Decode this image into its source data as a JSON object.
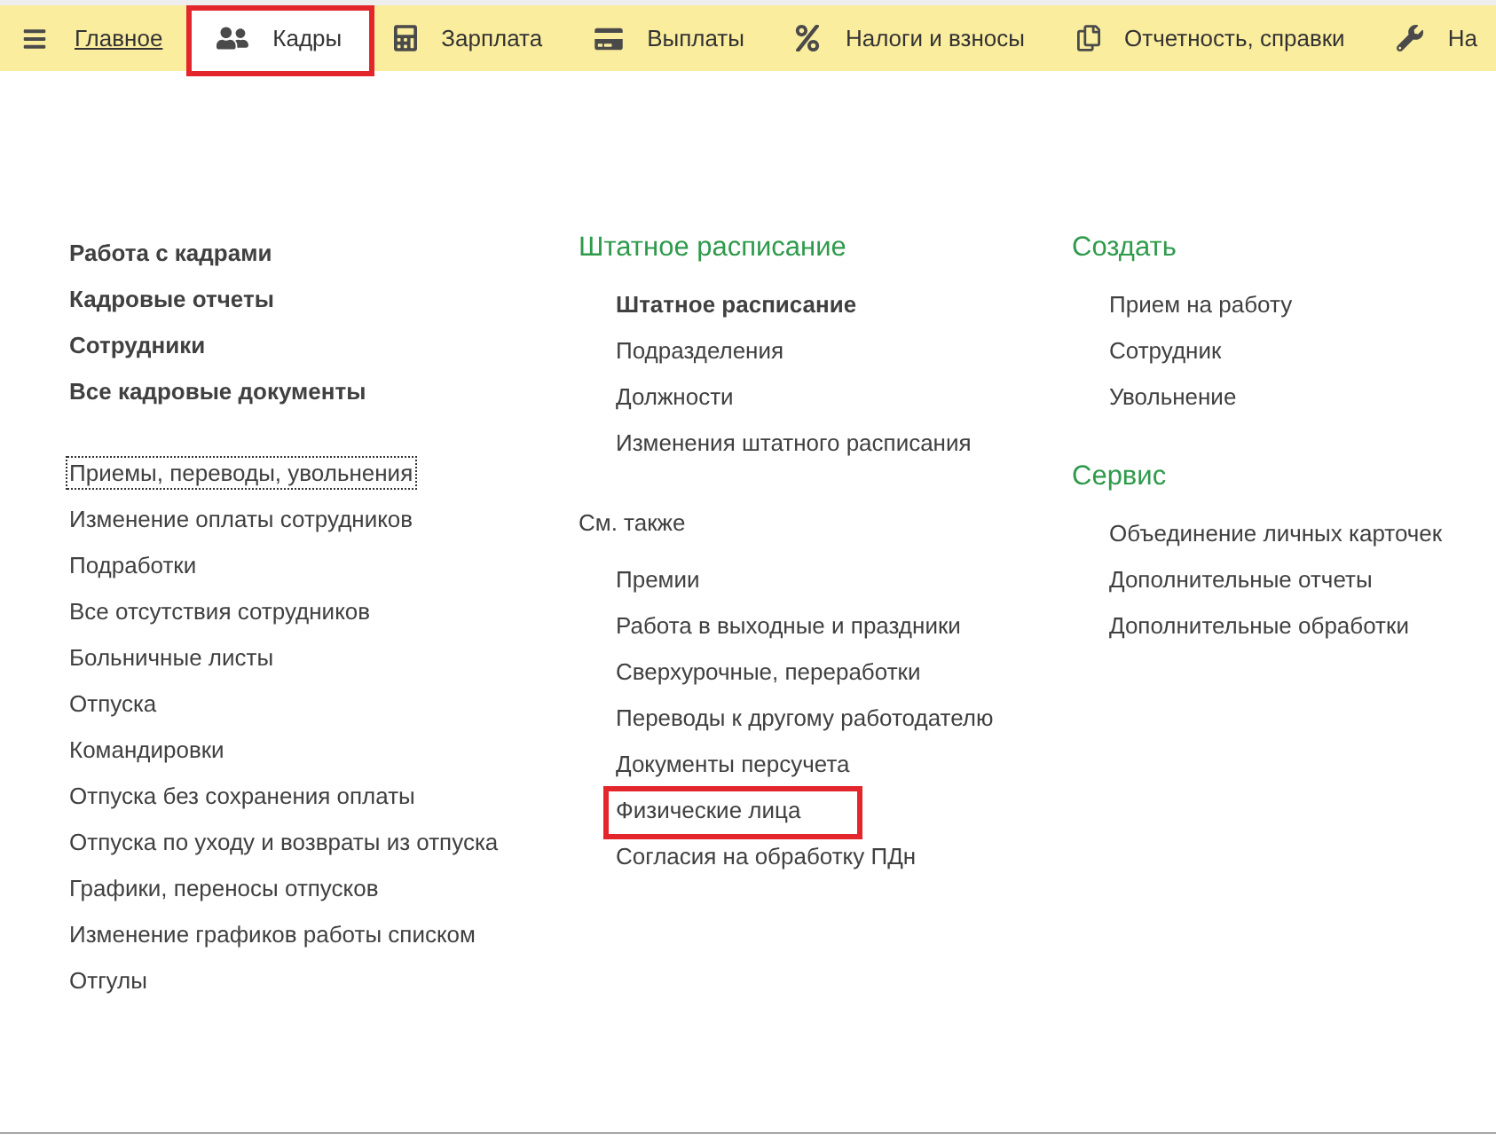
{
  "toolbar": {
    "sections": [
      {
        "kind": "link",
        "label": "Главное",
        "selected": false,
        "highlighted": false
      },
      {
        "kind": "section",
        "label": "Кадры",
        "selected": true,
        "highlighted": true
      },
      {
        "kind": "section",
        "label": "Зарплата",
        "selected": false,
        "highlighted": false
      },
      {
        "kind": "section",
        "label": "Выплаты",
        "selected": false,
        "highlighted": false
      },
      {
        "kind": "section",
        "label": "Налоги и взносы",
        "selected": false,
        "highlighted": false
      },
      {
        "kind": "section",
        "label": "Отчетность, справки",
        "selected": false,
        "highlighted": false
      },
      {
        "kind": "section",
        "label": "На",
        "selected": false,
        "highlighted": false
      }
    ]
  },
  "columns": [
    {
      "groups": [
        {
          "kind": "plain",
          "items": [
            {
              "label": "Работа с кадрами",
              "bold": true,
              "focused": false,
              "highlighted": false
            },
            {
              "label": "Кадровые отчеты",
              "bold": true,
              "focused": false,
              "highlighted": false
            },
            {
              "label": "Сотрудники",
              "bold": true,
              "focused": false,
              "highlighted": false
            },
            {
              "label": "Все кадровые документы",
              "bold": true,
              "focused": false,
              "highlighted": false
            }
          ]
        },
        {
          "kind": "plain",
          "items": [
            {
              "label": "Приемы, переводы, увольнения",
              "bold": false,
              "focused": true,
              "highlighted": false
            },
            {
              "label": "Изменение оплаты сотрудников",
              "bold": false,
              "focused": false,
              "highlighted": false
            },
            {
              "label": "Подработки",
              "bold": false,
              "focused": false,
              "highlighted": false
            },
            {
              "label": "Все отсутствия сотрудников",
              "bold": false,
              "focused": false,
              "highlighted": false
            },
            {
              "label": "Больничные листы",
              "bold": false,
              "focused": false,
              "highlighted": false
            },
            {
              "label": "Отпуска",
              "bold": false,
              "focused": false,
              "highlighted": false
            },
            {
              "label": "Командировки",
              "bold": false,
              "focused": false,
              "highlighted": false
            },
            {
              "label": "Отпуска без сохранения оплаты",
              "bold": false,
              "focused": false,
              "highlighted": false
            },
            {
              "label": "Отпуска по уходу и возвраты из отпуска",
              "bold": false,
              "focused": false,
              "highlighted": false
            },
            {
              "label": "Графики, переносы отпусков",
              "bold": false,
              "focused": false,
              "highlighted": false
            },
            {
              "label": "Изменение графиков работы списком",
              "bold": false,
              "focused": false,
              "highlighted": false
            },
            {
              "label": "Отгулы",
              "bold": false,
              "focused": false,
              "highlighted": false
            }
          ]
        }
      ]
    },
    {
      "groups": [
        {
          "kind": "heading",
          "title": "Штатное расписание",
          "items": [
            {
              "label": "Штатное расписание",
              "bold": true,
              "focused": false,
              "highlighted": false
            },
            {
              "label": "Подразделения",
              "bold": false,
              "focused": false,
              "highlighted": false
            },
            {
              "label": "Должности",
              "bold": false,
              "focused": false,
              "highlighted": false
            },
            {
              "label": "Изменения штатного расписания",
              "bold": false,
              "focused": false,
              "highlighted": false
            }
          ]
        },
        {
          "kind": "caption",
          "title": "См. также",
          "items": [
            {
              "label": "Премии",
              "bold": false,
              "focused": false,
              "highlighted": false
            },
            {
              "label": "Работа в выходные и праздники",
              "bold": false,
              "focused": false,
              "highlighted": false
            },
            {
              "label": "Сверхурочные, переработки",
              "bold": false,
              "focused": false,
              "highlighted": false
            },
            {
              "label": "Переводы к другому работодателю",
              "bold": false,
              "focused": false,
              "highlighted": false
            },
            {
              "label": "Документы персучета",
              "bold": false,
              "focused": false,
              "highlighted": false
            },
            {
              "label": "Физические лица",
              "bold": false,
              "focused": false,
              "highlighted": true
            },
            {
              "label": "Согласия на обработку ПДн",
              "bold": false,
              "focused": false,
              "highlighted": false
            }
          ]
        }
      ]
    },
    {
      "groups": [
        {
          "kind": "heading",
          "title": "Создать",
          "items": [
            {
              "label": "Прием на работу",
              "bold": false,
              "focused": false,
              "highlighted": false
            },
            {
              "label": "Сотрудник",
              "bold": false,
              "focused": false,
              "highlighted": false
            },
            {
              "label": "Увольнение",
              "bold": false,
              "focused": false,
              "highlighted": false
            }
          ]
        },
        {
          "kind": "heading",
          "title": "Сервис",
          "items": [
            {
              "label": "Объединение личных карточек",
              "bold": false,
              "focused": false,
              "highlighted": false
            },
            {
              "label": "Дополнительные отчеты",
              "bold": false,
              "focused": false,
              "highlighted": false
            },
            {
              "label": "Дополнительные обработки",
              "bold": false,
              "focused": false,
              "highlighted": false
            }
          ]
        }
      ]
    }
  ]
}
